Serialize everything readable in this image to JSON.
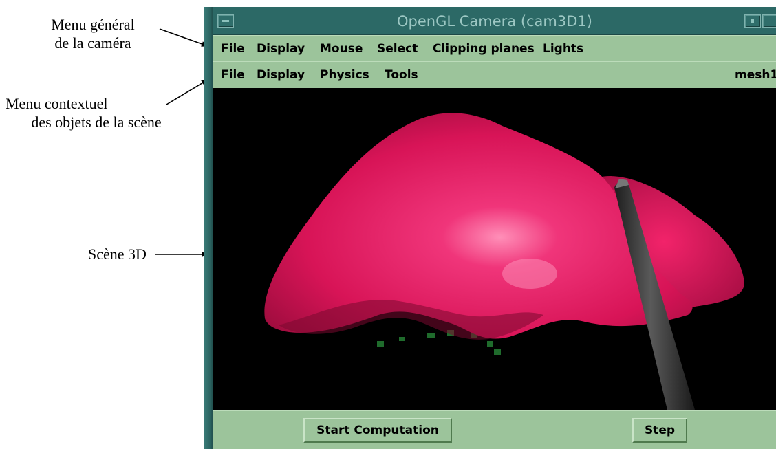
{
  "annotations": {
    "menu_general": [
      "Menu général",
      "de la caméra"
    ],
    "menu_contextuel": [
      "Menu contextuel",
      "des objets de la scène"
    ],
    "scene_3d": "Scène 3D"
  },
  "window": {
    "title": "OpenGL Camera (cam3D1)"
  },
  "main_menu": {
    "items": [
      "File",
      "Display",
      "Mouse",
      "Select",
      "Clipping planes",
      "Lights"
    ]
  },
  "context_menu": {
    "items": [
      "File",
      "Display",
      "Physics",
      "Tools"
    ],
    "object_name": "mesh1"
  },
  "buttons": {
    "start_computation": "Start Computation",
    "step": "Step"
  },
  "colors": {
    "window_frame": "#2f6e6b",
    "menu_background": "#9cc49b",
    "scene_background": "#000000",
    "mesh": "#e8185f",
    "tool": "#3a3a3a"
  }
}
